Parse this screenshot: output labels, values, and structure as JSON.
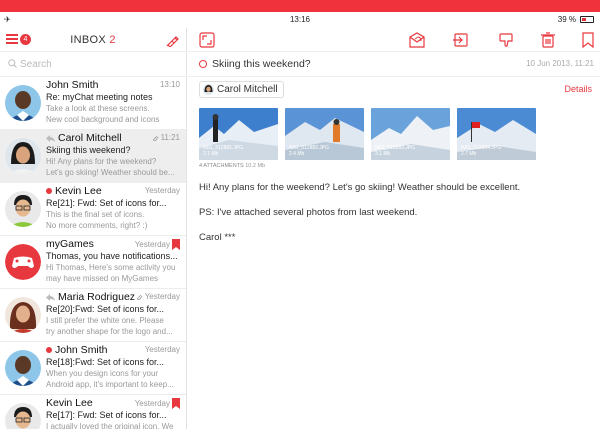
{
  "status_bar": {
    "airplane": "✈",
    "time": "13:16",
    "battery": "39 %"
  },
  "inbox": {
    "title": "INBOX",
    "count": "2",
    "menu_badge": "4",
    "search_placeholder": "Search"
  },
  "messages": [
    {
      "sender": "John Smith",
      "time": "13:10",
      "subject": "Re: myChat meeting notes",
      "preview1": "Take a look at these screens.",
      "preview2": "New cool background and icons",
      "unread": false,
      "reply": false,
      "bookmark": false,
      "selected": false
    },
    {
      "sender": "Carol Mitchell",
      "time": "11:21",
      "subject": "Skiing this weekend?",
      "preview1": "Hi! Any plans for the weekend?",
      "preview2": "Let's go skiing! Weather should be...",
      "unread": false,
      "reply": true,
      "bookmark": false,
      "selected": true
    },
    {
      "sender": "Kevin Lee",
      "time": "Yesterday",
      "subject": "Re[21]: Fwd: Set of icons for...",
      "preview1": "This is the final set of icons.",
      "preview2": "No more comments, right? :)",
      "unread": true,
      "reply": false,
      "bookmark": false,
      "selected": false
    },
    {
      "sender": "myGames",
      "time": "Yesterday",
      "subject": "Thomas, you have notifications...",
      "preview1": "Hi Thomas, Here's some activity you",
      "preview2": "may have missed on MyGames",
      "unread": false,
      "reply": false,
      "bookmark": true,
      "selected": false
    },
    {
      "sender": "Maria Rodriguez",
      "time": "Yesterday",
      "subject": "Re[20]:Fwd: Set of icons for...",
      "preview1": "I still prefer the white one. Please",
      "preview2": "try another shape for the logo and...",
      "unread": false,
      "reply": true,
      "bookmark": false,
      "selected": false
    },
    {
      "sender": "John Smith",
      "time": "Yesterday",
      "subject": "Re[18]:Fwd: Set of icons for...",
      "preview1": "When you design icons for your",
      "preview2": "Android app, it's important to keep...",
      "unread": true,
      "reply": false,
      "bookmark": false,
      "selected": false
    },
    {
      "sender": "Kevin Lee",
      "time": "Yesterday",
      "subject": "Re[17]: Fwd: Set of icons for...",
      "preview1": "I actually loved the original icon. We",
      "preview2": "",
      "unread": false,
      "reply": false,
      "bookmark": true,
      "selected": false
    }
  ],
  "reader": {
    "subject": "Skiing this weekend?",
    "date": "10 Jun 2013, 11:21",
    "from": "Carol Mitchell",
    "details_label": "Details",
    "attachments": [
      {
        "name": "IMG_312881.JPG",
        "size": "2.1 Mb"
      },
      {
        "name": "IMG_312882.JPG",
        "size": "2.4 Mb"
      },
      {
        "name": "IMG_312883.JPG",
        "size": "3.1 Mb"
      },
      {
        "name": "IMG_312884.JPG",
        "size": "2.7 Mb"
      }
    ],
    "attachments_label": "4 ATTACHMENTS",
    "attachments_size": "10.2 Mb",
    "body": [
      "Hi! Any plans for the weekend? Let's go skiing! Weather should be excellent.",
      "PS: I've attached several photos from last weekend.",
      "Carol ***"
    ]
  },
  "colors": {
    "accent": "#e8383f",
    "top_bar": "#f0323c"
  }
}
